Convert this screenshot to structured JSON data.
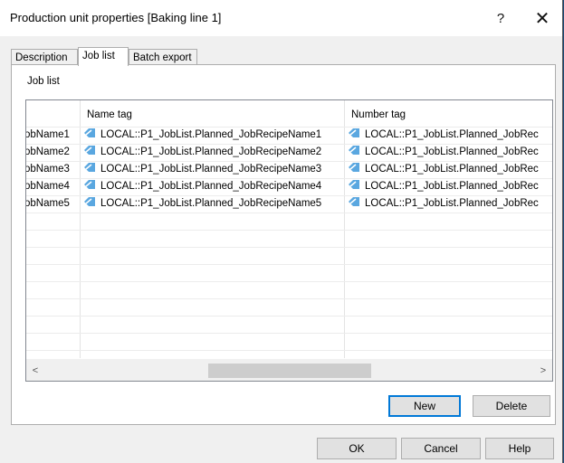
{
  "window": {
    "title": "Production unit properties [Baking line 1]",
    "help_glyph": "?",
    "close_glyph": "✕"
  },
  "tabs": [
    {
      "label": "Description",
      "active": false
    },
    {
      "label": "Job list",
      "active": true
    },
    {
      "label": "Batch export",
      "active": false
    }
  ],
  "job_list": {
    "group_label": "Job list",
    "columns": {
      "name_tag": "Name tag",
      "number_tag": "Number tag"
    },
    "rows": [
      {
        "name": "obName1",
        "name_tag": "LOCAL::P1_JobList.Planned_JobRecipeName1",
        "number_tag": "LOCAL::P1_JobList.Planned_JobRec"
      },
      {
        "name": "obName2",
        "name_tag": "LOCAL::P1_JobList.Planned_JobRecipeName2",
        "number_tag": "LOCAL::P1_JobList.Planned_JobRec"
      },
      {
        "name": "obName3",
        "name_tag": "LOCAL::P1_JobList.Planned_JobRecipeName3",
        "number_tag": "LOCAL::P1_JobList.Planned_JobRec"
      },
      {
        "name": "obName4",
        "name_tag": "LOCAL::P1_JobList.Planned_JobRecipeName4",
        "number_tag": "LOCAL::P1_JobList.Planned_JobRec"
      },
      {
        "name": "obName5",
        "name_tag": "LOCAL::P1_JobList.Planned_JobRecipeName5",
        "number_tag": "LOCAL::P1_JobList.Planned_JobRec"
      }
    ],
    "scroll_left": "<",
    "scroll_right": ">",
    "new_label": "New",
    "delete_label": "Delete"
  },
  "footer": {
    "ok_label": "OK",
    "cancel_label": "Cancel",
    "help_label": "Help"
  },
  "icons": {
    "tag_icon": "tag-icon"
  },
  "colors": {
    "tag_icon": "#5aa7e0",
    "default_button_border": "#0078d7"
  }
}
